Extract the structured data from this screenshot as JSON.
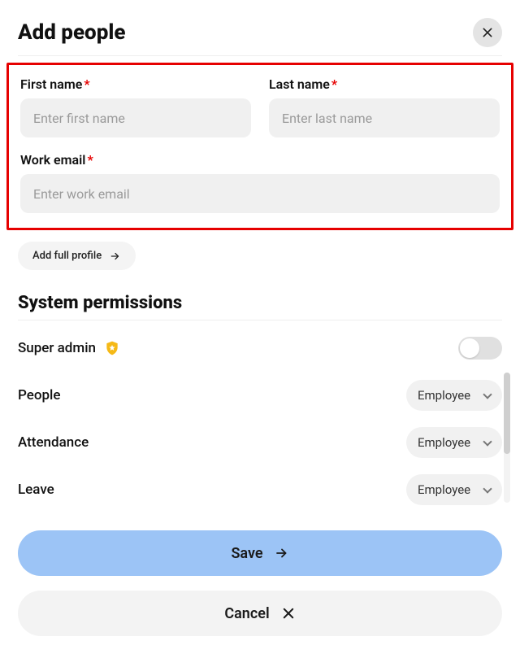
{
  "header": {
    "title": "Add people"
  },
  "form": {
    "firstName": {
      "label": "First name",
      "placeholder": "Enter first name"
    },
    "lastName": {
      "label": "Last name",
      "placeholder": "Enter last name"
    },
    "workEmail": {
      "label": "Work email",
      "placeholder": "Enter work email"
    },
    "addFullProfile": "Add full profile"
  },
  "permissions": {
    "sectionTitle": "System permissions",
    "superAdminLabel": "Super admin",
    "rows": [
      {
        "label": "People",
        "value": "Employee"
      },
      {
        "label": "Attendance",
        "value": "Employee"
      },
      {
        "label": "Leave",
        "value": "Employee"
      }
    ]
  },
  "footer": {
    "save": "Save",
    "cancel": "Cancel"
  }
}
